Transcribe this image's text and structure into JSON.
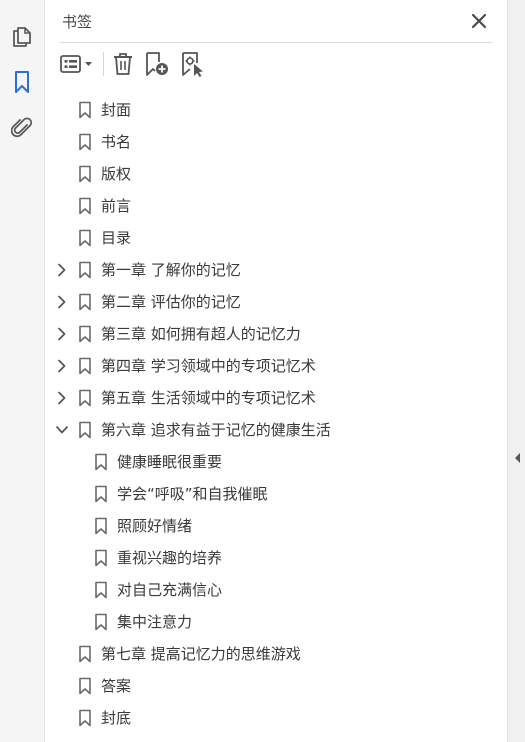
{
  "rail": {
    "items": [
      {
        "icon": "pages-icon",
        "active": false
      },
      {
        "icon": "bookmark-icon",
        "active": true
      },
      {
        "icon": "attachment-icon",
        "active": false
      }
    ]
  },
  "panel": {
    "title": "书签",
    "close_icon": "close-icon",
    "toolbar": [
      "options-menu-icon",
      "delete-icon",
      "new-bookmark-icon",
      "bookmark-from-selection-icon"
    ]
  },
  "bookmarks": [
    {
      "label": "封面",
      "level": 0,
      "twisty": "none"
    },
    {
      "label": "书名",
      "level": 0,
      "twisty": "none"
    },
    {
      "label": "版权",
      "level": 0,
      "twisty": "none"
    },
    {
      "label": "前言",
      "level": 0,
      "twisty": "none"
    },
    {
      "label": "目录",
      "level": 0,
      "twisty": "none"
    },
    {
      "label": "第一章  了解你的记忆",
      "level": 0,
      "twisty": "collapsed"
    },
    {
      "label": "第二章  评估你的记忆",
      "level": 0,
      "twisty": "collapsed"
    },
    {
      "label": "第三章  如何拥有超人的记忆力",
      "level": 0,
      "twisty": "collapsed"
    },
    {
      "label": "第四章  学习领域中的专项记忆术",
      "level": 0,
      "twisty": "collapsed"
    },
    {
      "label": "第五章  生活领域中的专项记忆术",
      "level": 0,
      "twisty": "collapsed"
    },
    {
      "label": "第六章  追求有益于记忆的健康生活",
      "level": 0,
      "twisty": "expanded"
    },
    {
      "label": "健康睡眠很重要",
      "level": 1,
      "twisty": "none"
    },
    {
      "label": "学会“呼吸”和自我催眠",
      "level": 1,
      "twisty": "none"
    },
    {
      "label": "照顾好情绪",
      "level": 1,
      "twisty": "none"
    },
    {
      "label": "重视兴趣的培养",
      "level": 1,
      "twisty": "none"
    },
    {
      "label": "对自己充满信心",
      "level": 1,
      "twisty": "none"
    },
    {
      "label": "集中注意力",
      "level": 1,
      "twisty": "none"
    },
    {
      "label": "第七章  提高记忆力的思维游戏",
      "level": 0,
      "twisty": "none"
    },
    {
      "label": "答案",
      "level": 0,
      "twisty": "none"
    },
    {
      "label": "封底",
      "level": 0,
      "twisty": "none"
    }
  ],
  "colors": {
    "accent": "#2d6fd2",
    "icon": "#5a5a5a",
    "text": "#3a3a3a"
  }
}
